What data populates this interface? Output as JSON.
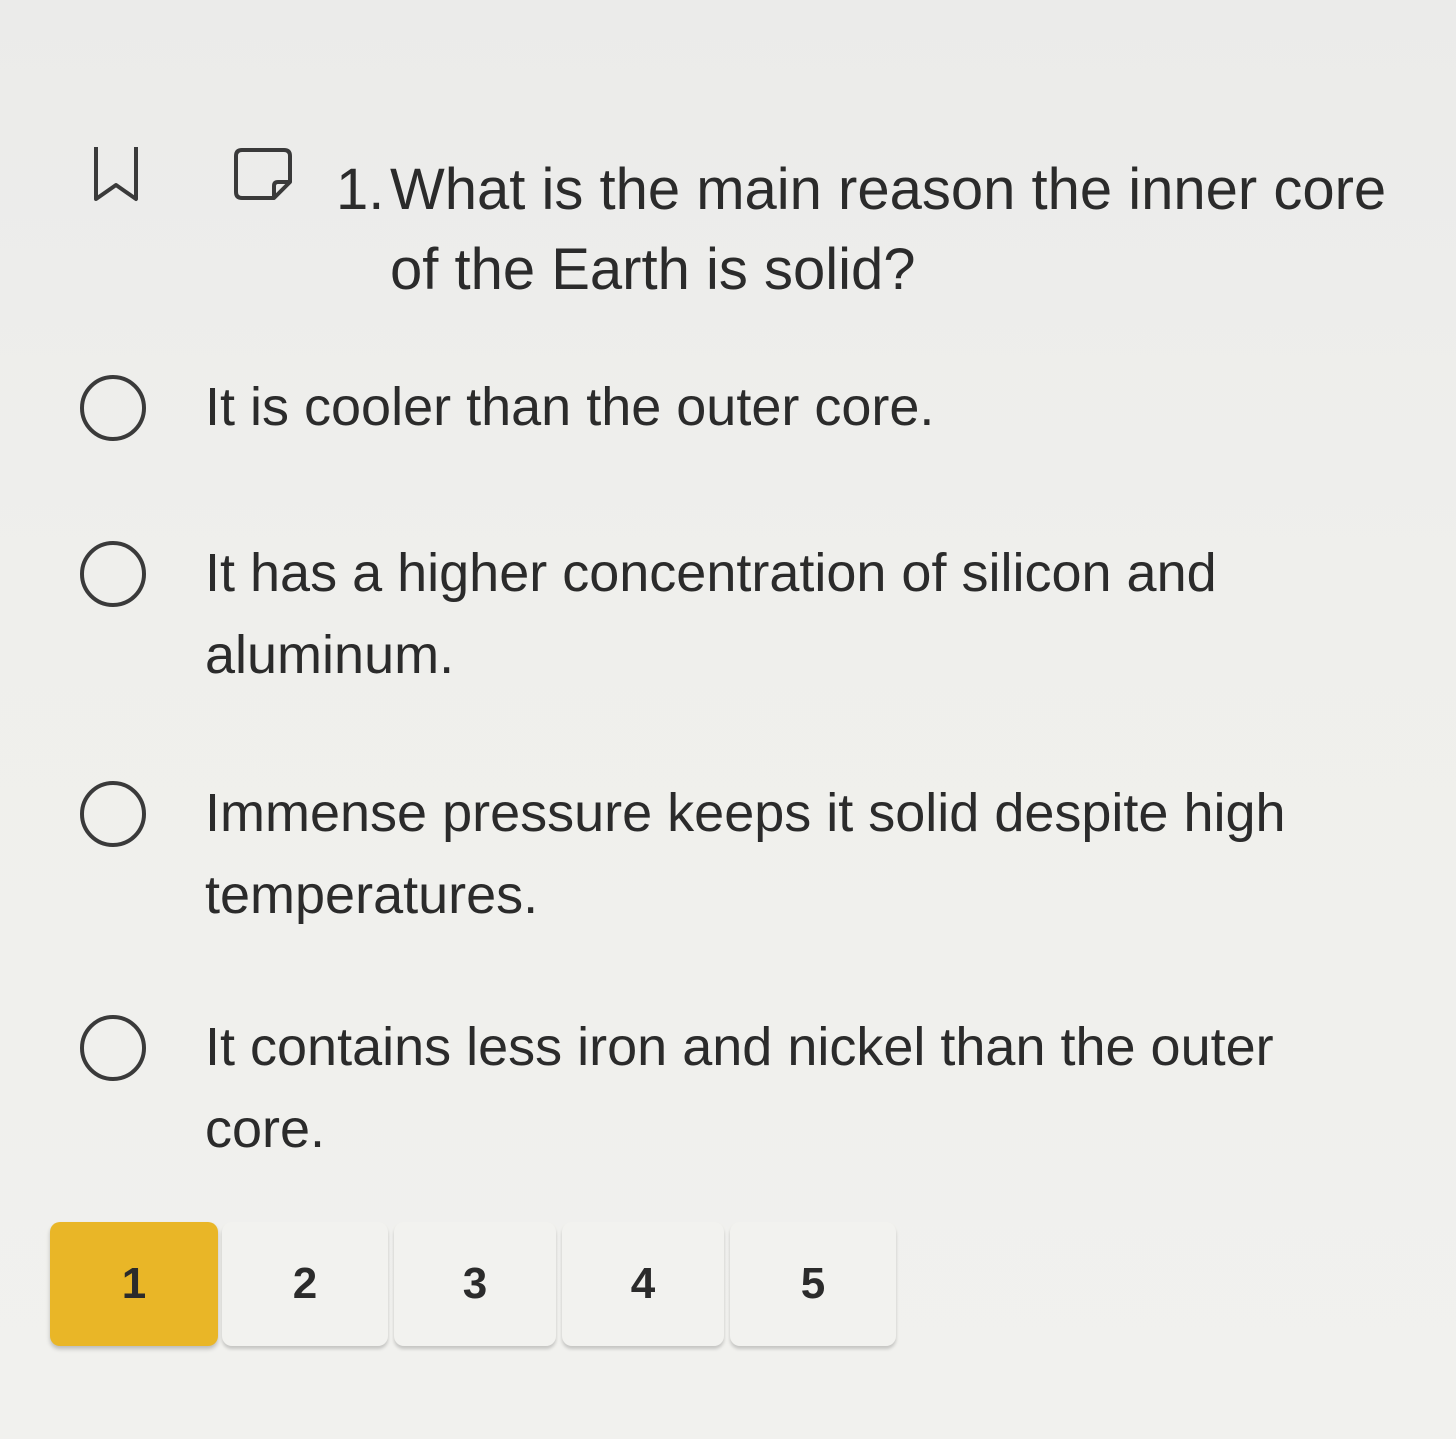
{
  "question": {
    "number": "1.",
    "text": "What is the main reason the inner core of the Earth is solid?"
  },
  "options": [
    {
      "label": "It is cooler than the outer core.",
      "selected": false
    },
    {
      "label": "It has a higher concentration of silicon and aluminum.",
      "selected": false
    },
    {
      "label": "Immense pressure keeps it solid despite high temperatures.",
      "selected": false
    },
    {
      "label": "It contains less iron and nickel than the outer core.",
      "selected": false
    }
  ],
  "pagination": {
    "pages": [
      "1",
      "2",
      "3",
      "4",
      "5"
    ],
    "current": "1",
    "active_color": "#e9b627"
  },
  "icons": {
    "bookmark": "bookmark-icon",
    "note": "note-icon",
    "radio": "radio-circle"
  }
}
